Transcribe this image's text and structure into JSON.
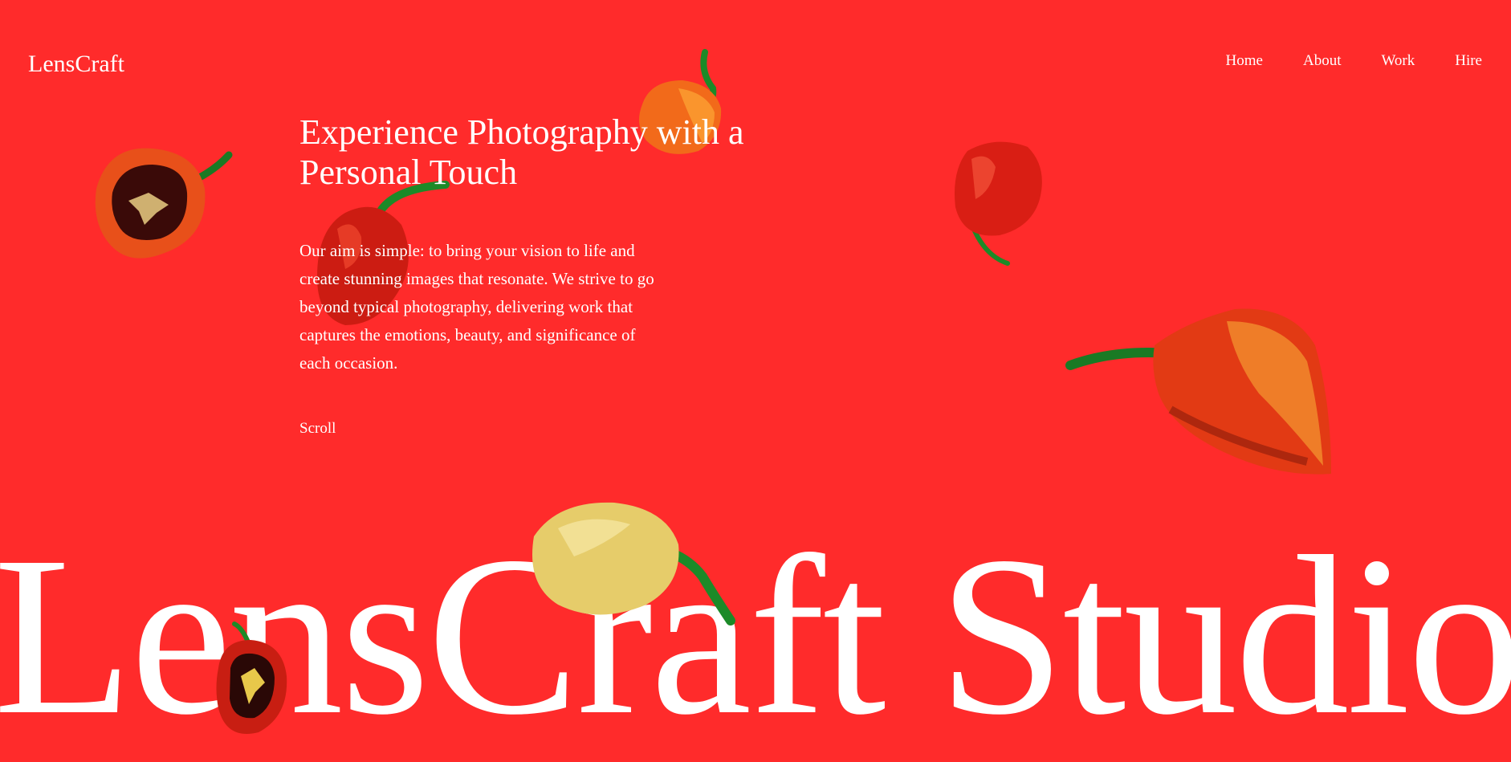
{
  "header": {
    "logo": "LensCraft",
    "nav": [
      "Home",
      "About",
      "Work",
      "Hire"
    ]
  },
  "hero": {
    "title": "Experience Photography with a Personal Touch",
    "description": "Our aim is simple: to bring your vision to life and create stunning images that resonate. We strive to go beyond typical photography, delivering work that captures the emotions, beauty, and significance of each occasion.",
    "scroll_label": "Scroll"
  },
  "wordmark": "LensCraft Studio",
  "colors": {
    "background": "#ff2b2b",
    "text": "#ffffff",
    "pepper_red": "#d81d14",
    "pepper_orange": "#f0541a",
    "pepper_yellow": "#e8d070",
    "stem_green": "#1a8a2a"
  },
  "decorations": [
    "pepper-image",
    "pepper-image",
    "pepper-image",
    "pepper-image",
    "pepper-image",
    "pepper-image",
    "pepper-image"
  ]
}
